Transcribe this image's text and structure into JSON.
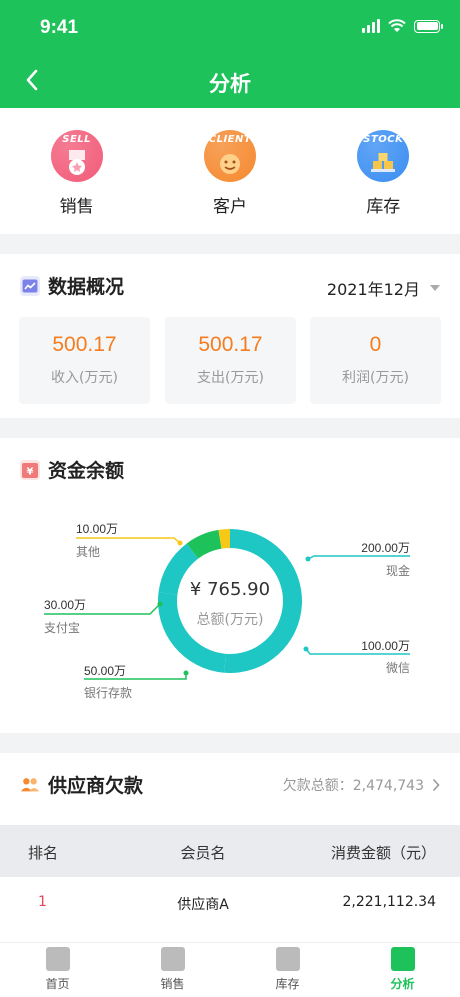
{
  "status": {
    "time": "9:41"
  },
  "header": {
    "title": "分析"
  },
  "categories": [
    {
      "tag": "SELL",
      "label": "销售",
      "color": "#f25b78"
    },
    {
      "tag": "CLIENT",
      "label": "客户",
      "color": "#f5892f"
    },
    {
      "tag": "STOCK",
      "label": "库存",
      "color": "#3a8ef2"
    }
  ],
  "overview": {
    "title": "数据概况",
    "month": "2021年12月",
    "stats": [
      {
        "value": "500.17",
        "label": "收入(万元)"
      },
      {
        "value": "500.17",
        "label": "支出(万元)"
      },
      {
        "value": "0",
        "label": "利润(万元)"
      }
    ]
  },
  "funds": {
    "title": "资金余额",
    "center_value": "¥ 765.90",
    "center_label": "总额(万元)"
  },
  "chart_data": {
    "type": "pie",
    "style": "donut",
    "slices": [
      {
        "name": "现金",
        "value": 200.0,
        "label": "200.00万",
        "color": "#1ec6c4"
      },
      {
        "name": "微信",
        "value": 100.0,
        "label": "100.00万",
        "color": "#1ec6c4"
      },
      {
        "name": "银行存款",
        "value": 50.0,
        "label": "50.00万",
        "color": "#1ec6c4"
      },
      {
        "name": "支付宝",
        "value": 30.0,
        "label": "30.00万",
        "color": "#1ec25a"
      },
      {
        "name": "其他",
        "value": 10.0,
        "label": "10.00万",
        "color": "#f8c817"
      }
    ]
  },
  "supplier": {
    "title": "供应商欠款",
    "total_label": "欠款总额：2,474,743",
    "columns": [
      "排名",
      "会员名",
      "消费金额（元）"
    ],
    "rows": [
      {
        "rank": "1",
        "name": "供应商A",
        "amount": "2,221,112.34"
      }
    ]
  },
  "tabs": [
    {
      "label": "首页",
      "active": false
    },
    {
      "label": "销售",
      "active": false
    },
    {
      "label": "库存",
      "active": false
    },
    {
      "label": "分析",
      "active": true
    }
  ]
}
